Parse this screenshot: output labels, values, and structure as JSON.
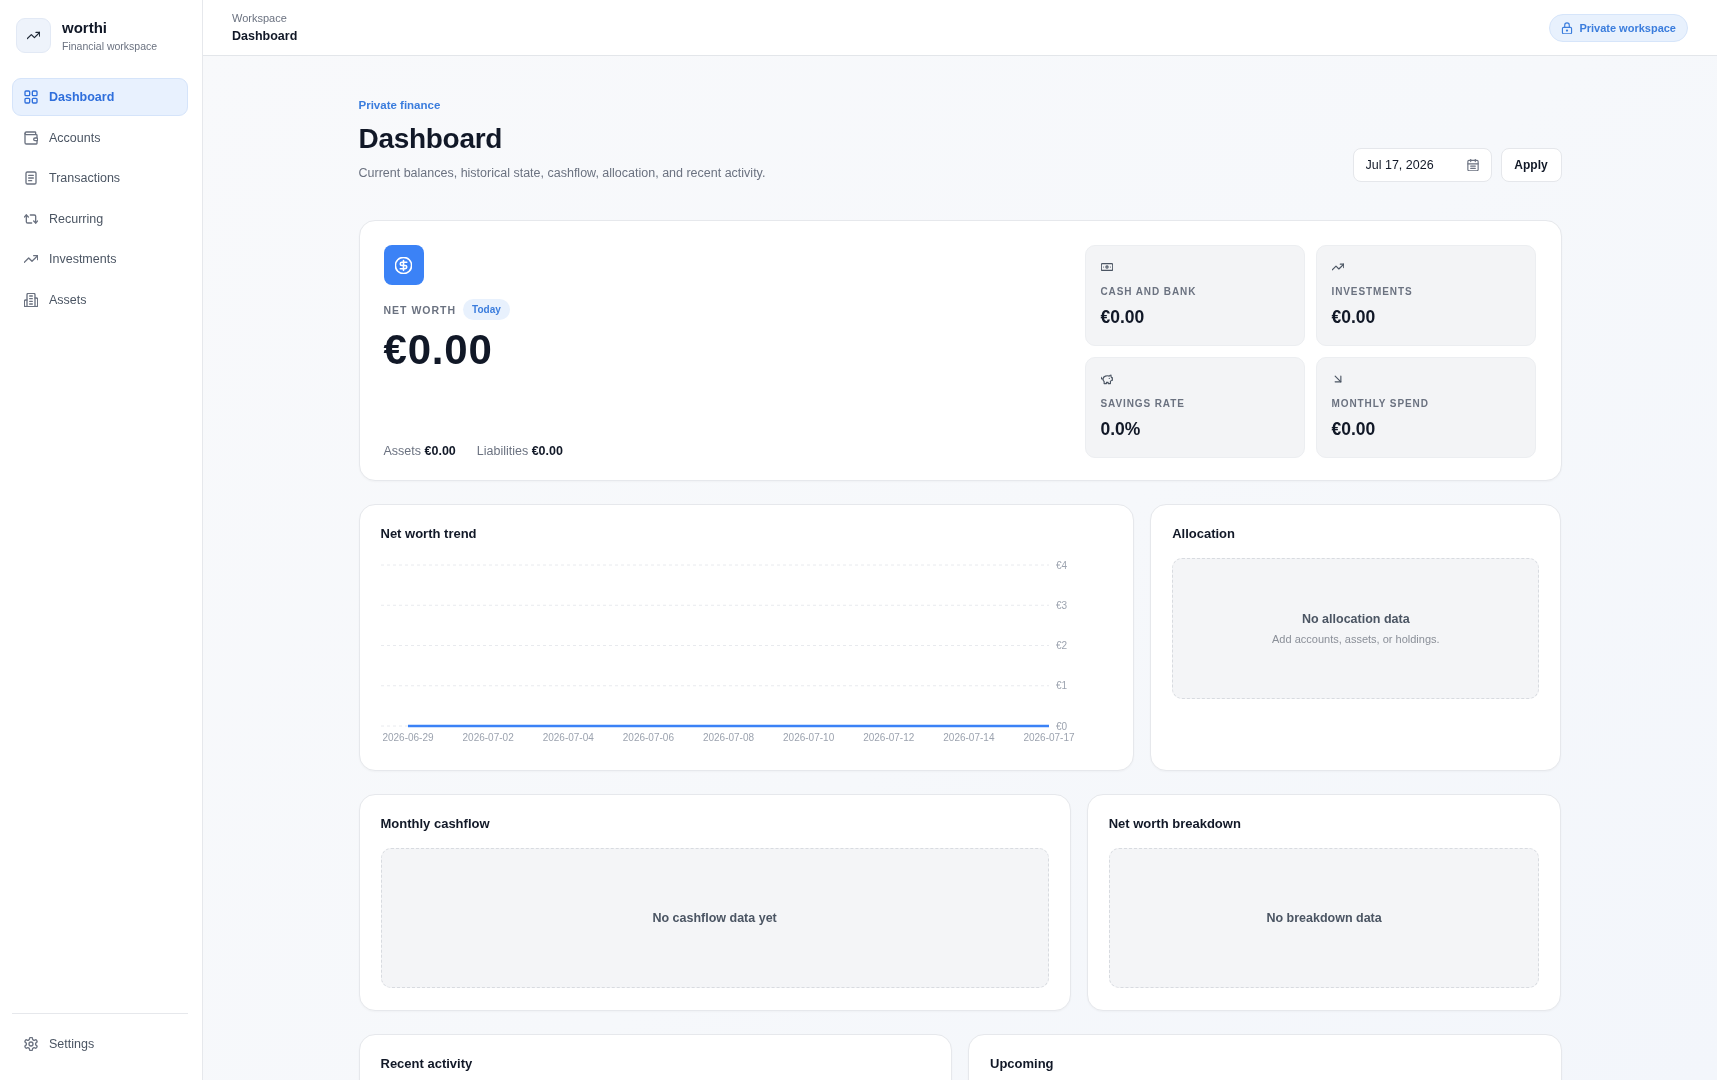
{
  "sidebar": {
    "brand": {
      "name": "worthi",
      "subtitle": "Financial workspace"
    },
    "items": [
      {
        "label": "Dashboard",
        "selected": true
      },
      {
        "label": "Accounts",
        "selected": false
      },
      {
        "label": "Transactions",
        "selected": false
      },
      {
        "label": "Recurring",
        "selected": false
      },
      {
        "label": "Investments",
        "selected": false
      },
      {
        "label": "Assets",
        "selected": false
      }
    ],
    "footer_items": [
      {
        "label": "Settings",
        "selected": false
      }
    ]
  },
  "top_bar": {
    "breadcrumb": {
      "parent": "Workspace",
      "current": "Dashboard"
    },
    "workspace_badge": "Private workspace"
  },
  "header": {
    "eyebrow": "Private finance",
    "title": "Dashboard",
    "subtitle": "Current balances, historical state, cashflow, allocation, and recent activity.",
    "date_field": {
      "value": "Jul 17, 2026"
    },
    "apply_button": "Apply"
  },
  "net_worth": {
    "label": "NET WORTH",
    "period": "Today",
    "value": "€0.00",
    "totals": [
      "Assets **€0.00**",
      "Liabilities **€0.00**"
    ],
    "stats": [
      {
        "label": "CASH AND BANK",
        "value": "€0.00"
      },
      {
        "label": "INVESTMENTS",
        "value": "€0.00"
      },
      {
        "label": "SAVINGS RATE",
        "value": "0.0%"
      },
      {
        "label": "MONTHLY SPEND",
        "value": "€0.00"
      }
    ]
  },
  "trend": {
    "title": "Net worth trend",
    "chart_data": {
      "type": "line",
      "x": [
        "2026-06-29",
        "2026-07-02",
        "2026-07-04",
        "2026-07-06",
        "2026-07-08",
        "2026-07-10",
        "2026-07-12",
        "2026-07-14",
        "2026-07-17"
      ],
      "series": [
        {
          "color": "#3b82f6",
          "values": [
            0,
            0,
            0,
            0,
            0,
            0,
            0,
            0,
            0
          ]
        }
      ],
      "ylim": [
        0,
        4
      ],
      "yticks": [
        {
          "value": 0,
          "label": "€0"
        },
        {
          "value": 1,
          "label": "€1"
        },
        {
          "value": 2,
          "label": "€2"
        },
        {
          "value": 3,
          "label": "€3"
        },
        {
          "value": 4,
          "label": "€4"
        }
      ],
      "grid": true
    }
  },
  "allocation": {
    "title": "Allocation",
    "empty_title": "No allocation data",
    "empty_hint": "Add accounts, assets, or holdings."
  },
  "cashflow": {
    "title": "Monthly cashflow",
    "empty_text": "No cashflow data yet"
  },
  "breakdown": {
    "title": "Net worth breakdown",
    "empty_text": "No breakdown data"
  },
  "recent_activity": {
    "title": "Recent activity"
  },
  "upcoming": {
    "title": "Upcoming"
  }
}
